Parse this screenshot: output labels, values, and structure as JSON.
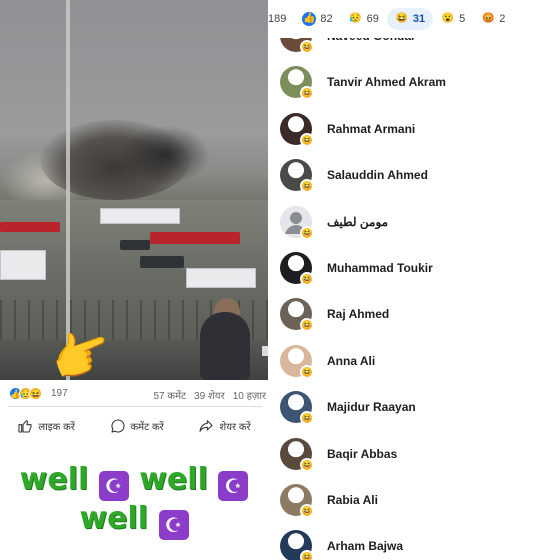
{
  "post": {
    "reaction_count": "197",
    "comments": "57 कमेंट",
    "shares": "39 शेयर",
    "views": "10 हज़ार",
    "actions": {
      "like": "लाइक करें",
      "comment": "कमेंट करें",
      "share": "शेयर करें"
    },
    "caption_words": [
      "well",
      "well",
      "well"
    ]
  },
  "reaction_tabs": [
    {
      "count": "189",
      "icon": "all"
    },
    {
      "count": "82",
      "icon": "like-icon"
    },
    {
      "count": "69",
      "icon": "care-icon"
    },
    {
      "count": "31",
      "icon": "haha-icon"
    },
    {
      "count": "5",
      "icon": "wow-icon"
    },
    {
      "count": "2",
      "icon": "angry-icon"
    }
  ],
  "people": [
    {
      "name": "Naveed Gondal",
      "avatar_color": "#6b4b3a"
    },
    {
      "name": "Tanvir Ahmed Akram",
      "avatar_color": "#7c8f5a"
    },
    {
      "name": "Rahmat Armani",
      "avatar_color": "#3a2b28"
    },
    {
      "name": "Salauddin Ahmed",
      "avatar_color": "#4a4a48"
    },
    {
      "name": "مومن لطيف",
      "avatar_color": "#d8dadf"
    },
    {
      "name": "Muhammad Toukir",
      "avatar_color": "#1e1e22"
    },
    {
      "name": "Raj  Ahmed",
      "avatar_color": "#6d6258"
    },
    {
      "name": "Anna Ali",
      "avatar_color": "#d9b79c"
    },
    {
      "name": "Majidur Raayan",
      "avatar_color": "#3b5572"
    },
    {
      "name": "Baqir Abbas",
      "avatar_color": "#5a4a3e"
    },
    {
      "name": "Rabia Ali",
      "avatar_color": "#8c7a63"
    },
    {
      "name": "Arham Bajwa",
      "avatar_color": "#233a5a"
    }
  ],
  "colors": {
    "accent": "#1877f2",
    "haha": "#f7b125",
    "active_tab": "#e7f0fd",
    "caption_green": "#2fa82a"
  }
}
